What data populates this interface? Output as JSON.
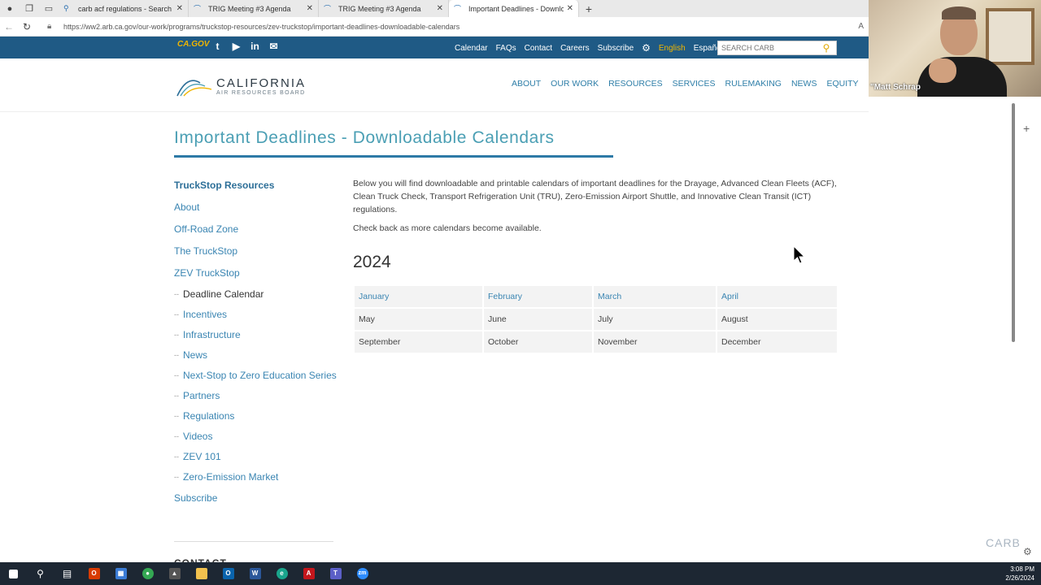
{
  "browser": {
    "tabs": [
      {
        "label": "carb acf regulations - Search",
        "icon": "search-icon"
      },
      {
        "label": "TRIG Meeting #3 Agenda",
        "icon": "carb-icon"
      },
      {
        "label": "TRIG Meeting #3 Agenda",
        "icon": "carb-icon"
      },
      {
        "label": "Important Deadlines - Downloac",
        "icon": "carb-icon"
      }
    ],
    "url": "https://ww2.arb.ca.gov/our-work/programs/truckstop-resources/zev-truckstop/important-deadlines-downloadable-calendars"
  },
  "topbar": {
    "cagov": "CA.GOV",
    "links": [
      "Calendar",
      "FAQs",
      "Contact",
      "Careers",
      "Subscribe"
    ],
    "lang_en": "English",
    "lang_es": "Español",
    "search_placeholder": "SEARCH CARB"
  },
  "header": {
    "logo_title": "CALIFORNIA",
    "logo_subtitle": "AIR RESOURCES BOARD",
    "nav": [
      "ABOUT",
      "OUR WORK",
      "RESOURCES",
      "SERVICES",
      "RULEMAKING",
      "NEWS",
      "EQUITY"
    ]
  },
  "page": {
    "title": "Important Deadlines - Downloadable Calendars",
    "intro": "Below you will find downloadable and printable calendars of important deadlines for the Drayage, Advanced Clean Fleets (ACF), Clean Truck Check, Transport Refrigeration Unit (TRU), Zero-Emission Airport Shuttle, and Innovative Clean Transit (ICT) regulations.",
    "checkback": "Check back as more calendars become available.",
    "year": "2024",
    "months": [
      [
        "January",
        "February",
        "March",
        "April"
      ],
      [
        "May",
        "June",
        "July",
        "August"
      ],
      [
        "September",
        "October",
        "November",
        "December"
      ]
    ]
  },
  "sidenav": {
    "heading": "TruckStop Resources",
    "items": [
      "About",
      "Off-Road Zone",
      "The TruckStop",
      "ZEV TruckStop"
    ],
    "subitems": [
      "Deadline Calendar",
      "Incentives",
      "Infrastructure",
      "News",
      "Next-Stop to Zero Education Series",
      "Partners",
      "Regulations",
      "Videos",
      "ZEV 101",
      "Zero-Emission Market"
    ],
    "subscribe": "Subscribe",
    "contact": "CONTACT"
  },
  "webcam": {
    "name": "\"Matt Schrap"
  },
  "corner_logo": "CARB",
  "taskbar": {
    "time": "3:08 PM",
    "date": "2/26/2024"
  },
  "colors": {
    "site_blue": "#1f5a85",
    "accent_gold": "#f0b500",
    "link": "#3a85b2",
    "title": "#4b9fb4"
  }
}
